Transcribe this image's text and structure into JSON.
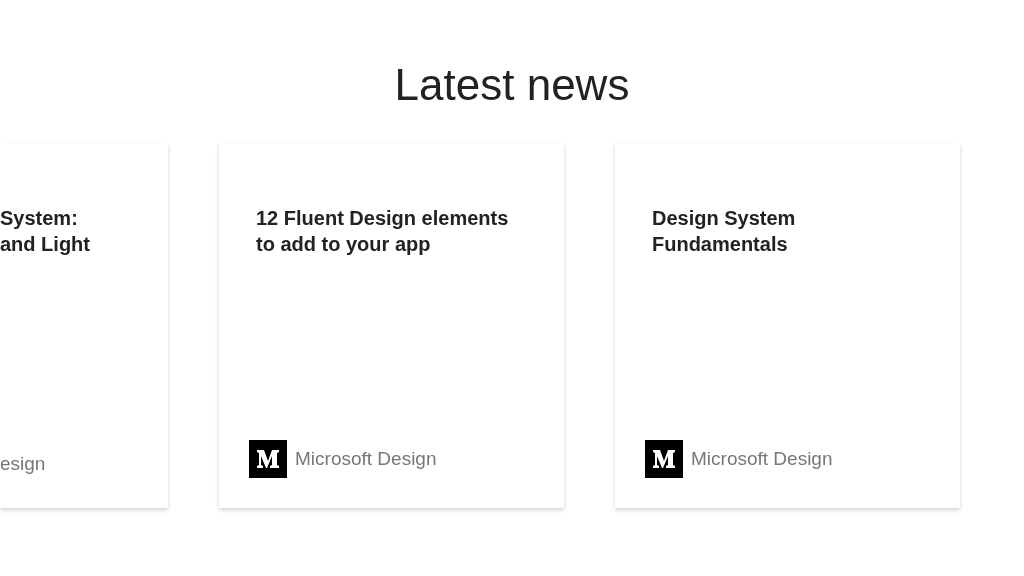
{
  "heading": "Latest news",
  "cards": [
    {
      "kind": "clipped",
      "title_lines": [
        "System:",
        "and Light"
      ],
      "logo": false,
      "source": "esign"
    },
    {
      "kind": "full",
      "title_lines": [
        "12 Fluent Design elements",
        "to add to your app"
      ],
      "logo": true,
      "source": "Microsoft Design"
    },
    {
      "kind": "full",
      "title_lines": [
        "Design System",
        "Fundamentals"
      ],
      "logo": true,
      "source": "Microsoft Design"
    }
  ]
}
